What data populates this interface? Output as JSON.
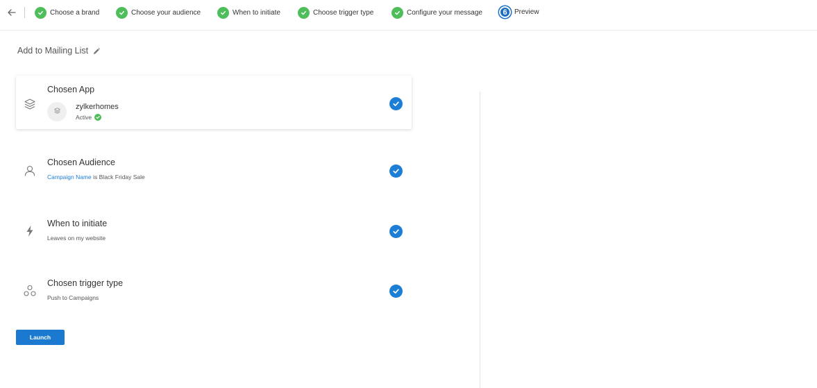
{
  "steps": [
    {
      "number": "",
      "label": "Choose a brand",
      "status": "done"
    },
    {
      "number": "",
      "label": "Choose your audience",
      "status": "done"
    },
    {
      "number": "",
      "label": "When to initiate",
      "status": "done"
    },
    {
      "number": "",
      "label": "Choose trigger type",
      "status": "done"
    },
    {
      "number": "",
      "label": "Configure your message",
      "status": "done"
    },
    {
      "number": "6",
      "label": "Preview",
      "status": "current"
    }
  ],
  "page": {
    "title": "Add to Mailing List"
  },
  "cards": {
    "app": {
      "title": "Chosen App",
      "app_name": "zylkerhomes",
      "app_status": "Active",
      "icon": "layers-icon"
    },
    "audience": {
      "title": "Chosen Audience",
      "link_text": "Campaign Name",
      "rest_text": " is Black Friday Sale",
      "icon": "user-icon"
    },
    "initiate": {
      "title": "When to initiate",
      "subtitle": "Leaves on my website",
      "icon": "lightning-icon"
    },
    "trigger": {
      "title": "Chosen trigger type",
      "subtitle": "Push to Campaigns",
      "icon": "trigger-network-icon"
    }
  },
  "actions": {
    "launch_label": "Launch"
  },
  "colors": {
    "accent": "#1d7ed6",
    "success": "#4fbd5a",
    "current_step": "#1b6ec2"
  }
}
